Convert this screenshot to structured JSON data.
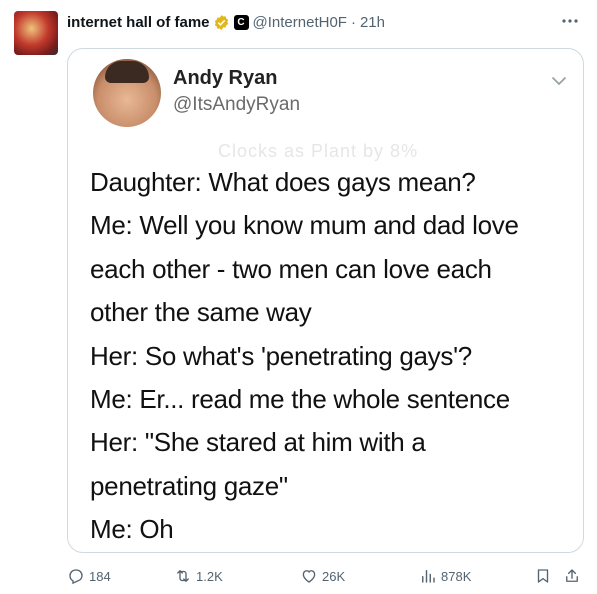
{
  "post": {
    "display_name": "internet hall of fame",
    "handle": "@InternetH0F",
    "separator": "·",
    "time": "21h",
    "affiliate_badge": "C",
    "icons": {
      "verified": "verified-badge-icon",
      "more": "more-icon"
    },
    "colors": {
      "verified_gold": "#e2b719",
      "muted": "#536471",
      "border": "#cfd9de"
    }
  },
  "media": {
    "author_name": "Andy Ryan",
    "author_handle": "@ItsAndyRyan",
    "faded_text": "Clocks as Plant by 8%",
    "lines": [
      "Daughter: What does gays mean?",
      "Me: Well you know mum and dad love",
      "each other - two men can love each",
      "other the same way",
      "Her: So what's 'penetrating gays'?",
      "Me: Er... read me the whole sentence",
      "Her: \"She stared at him with a",
      "penetrating gaze\"",
      "Me: Oh"
    ]
  },
  "actions": {
    "replies": "184",
    "reposts": "1.2K",
    "likes": "26K",
    "views": "878K"
  }
}
